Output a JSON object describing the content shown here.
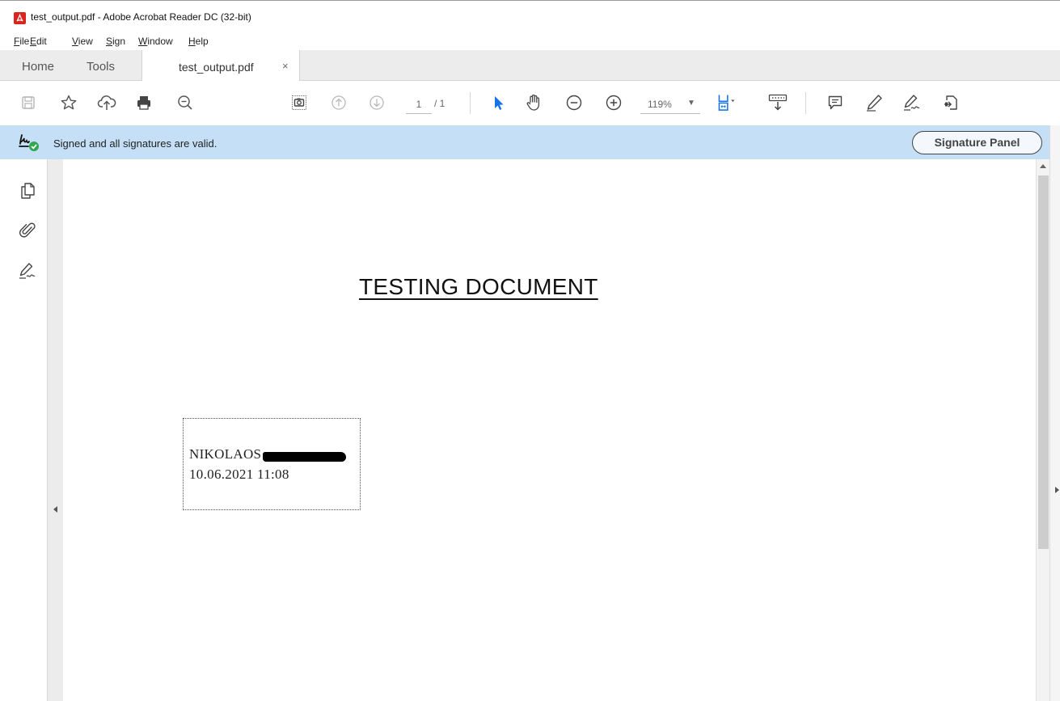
{
  "window": {
    "title": "test_output.pdf - Adobe Acrobat Reader DC (32-bit)",
    "icon": "pdf-file-icon"
  },
  "menu": {
    "items": [
      "File",
      "Edit",
      "View",
      "Sign",
      "Window",
      "Help"
    ]
  },
  "tabs": {
    "home": "Home",
    "tools": "Tools",
    "document": "test_output.pdf",
    "close": "×"
  },
  "toolbar": {
    "icons": [
      "save-icon",
      "bookmark-star-icon",
      "upload-cloud-icon",
      "print-icon",
      "find-zoom-icon",
      "snapshot-icon",
      "previous-page-icon",
      "next-page-icon",
      "select-arrow-icon",
      "hand-icon",
      "zoom-out-icon",
      "zoom-in-icon",
      "fit-page-icon",
      "keyboard-scroll-icon",
      "comment-icon",
      "highlight-icon",
      "sign-icon",
      "share-icon"
    ],
    "page_current": "1",
    "page_total": "/ 1",
    "zoom": "119%",
    "accent_color": "#1473e6"
  },
  "signature_bar": {
    "message": "Signed and all signatures are valid.",
    "panel_button": "Signature Panel",
    "background": "#c5e0f6",
    "valid_color": "#2fa84f"
  },
  "left_nav": {
    "icons": [
      "page-thumbnails-icon",
      "attachments-icon",
      "signatures-icon"
    ]
  },
  "document": {
    "title": "TESTING DOCUMENT",
    "signature": {
      "name": "NIKOLAOS",
      "datetime": "10.06.2021 11:08"
    }
  }
}
